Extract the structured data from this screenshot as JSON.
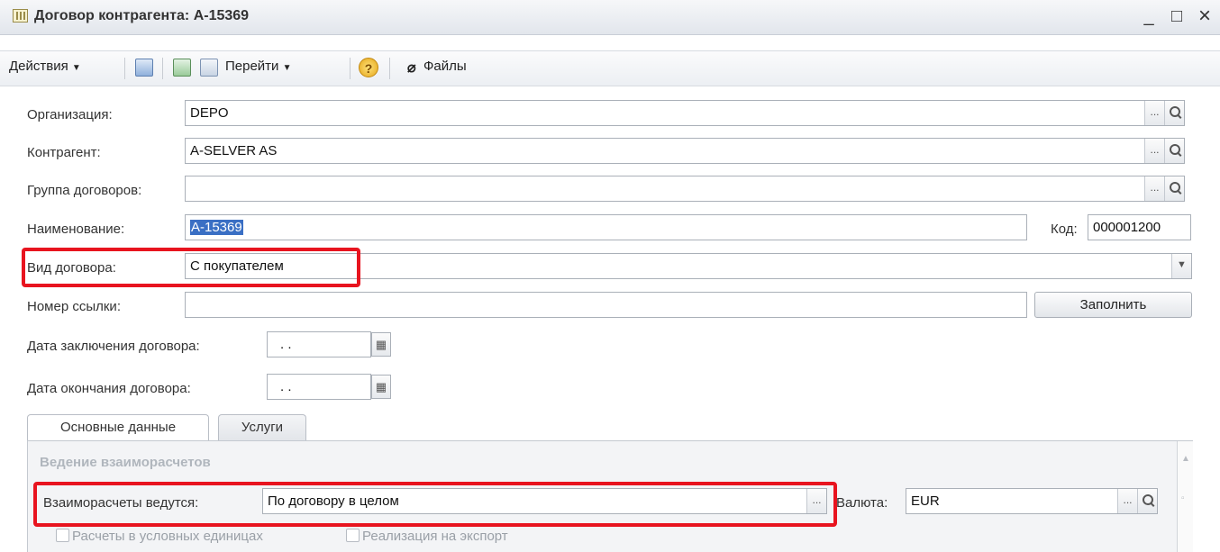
{
  "window": {
    "title": "Договор контрагента: А-15369",
    "minimize": "_",
    "maximize": "□",
    "close": "×"
  },
  "toolbar": {
    "actions": "Действия",
    "goto": "Перейти",
    "help": "?",
    "files": "Файлы"
  },
  "form": {
    "organization": {
      "label": "Организация:",
      "value": "DEPO"
    },
    "counterparty": {
      "label": "Контрагент:",
      "value": "A-SELVER AS"
    },
    "contract_group": {
      "label": "Группа договоров:",
      "value": ""
    },
    "name": {
      "label": "Наименование:",
      "value": "А-15369"
    },
    "code": {
      "label": "Код:",
      "value": "000001200"
    },
    "contract_type": {
      "label": "Вид договора:",
      "value": "С покупателем"
    },
    "reference_number": {
      "label": "Номер ссылки:",
      "value": ""
    },
    "fill_button": "Заполнить",
    "date_signed": {
      "label": "Дата заключения договора:",
      "value": ". ."
    },
    "date_end": {
      "label": "Дата окончания договора:",
      "value": ". ."
    }
  },
  "tabs": [
    {
      "label": "Основные данные"
    },
    {
      "label": "Услуги"
    }
  ],
  "panel": {
    "section_title": "Ведение взаиморасчетов",
    "settlements": {
      "label": "Взаиморасчеты ведутся:",
      "value": "По договору в целом"
    },
    "currency": {
      "label": "Валюта:",
      "value": "EUR"
    },
    "cb_conditional_units": "Расчеты в условных единицах",
    "cb_export": "Реализация на экспорт"
  },
  "colors": {
    "highlight": "#e8141f",
    "selection": "#3a6fc4"
  }
}
